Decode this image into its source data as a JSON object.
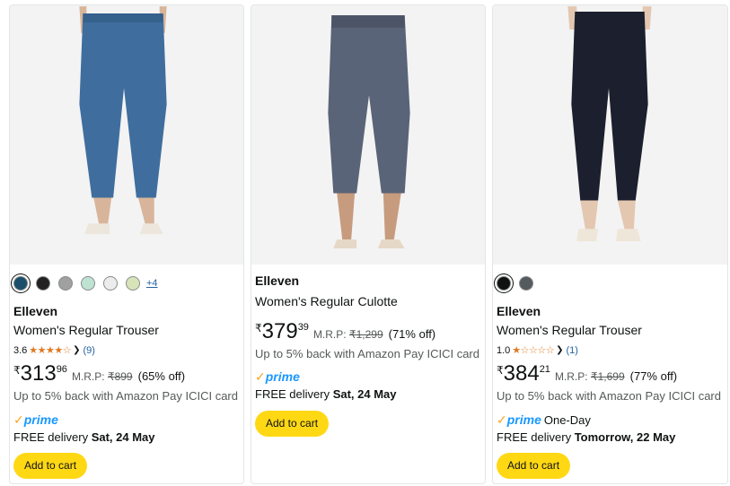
{
  "products": [
    {
      "image_alt": "Blue regular trouser",
      "colors": [
        "#1b4f6b",
        "#222222",
        "#a0a0a0",
        "#bfe3d3",
        "#ececec",
        "#d7e4b8"
      ],
      "more_colors": "+4",
      "brand": "Elleven",
      "title": "Women's Regular Trouser",
      "rating": "3.6",
      "stars": "★★★★☆",
      "review_count": "(9)",
      "price_currency": "₹",
      "price_whole": "313",
      "price_fraction": "96",
      "mrp_label": "M.R.P:",
      "mrp_value": "₹899",
      "discount": "(65% off)",
      "cashback": "Up to 5% back with Amazon Pay ICICI card",
      "prime_label": "prime",
      "prime_extra": "",
      "delivery_prefix": "FREE delivery",
      "delivery_date": "Sat, 24 May",
      "cart_label": "Add to cart"
    },
    {
      "image_alt": "Grey culotte",
      "colors": [],
      "more_colors": "",
      "brand": "Elleven",
      "title": "Women's Regular Culotte",
      "rating": "",
      "stars": "",
      "review_count": "",
      "price_currency": "₹",
      "price_whole": "379",
      "price_fraction": "39",
      "mrp_label": "M.R.P:",
      "mrp_value": "₹1,299",
      "discount": "(71% off)",
      "cashback": "Up to 5% back with Amazon Pay ICICI card",
      "prime_label": "prime",
      "prime_extra": "",
      "delivery_prefix": "FREE delivery",
      "delivery_date": "Sat, 24 May",
      "cart_label": "Add to cart"
    },
    {
      "image_alt": "Black regular trouser",
      "colors": [
        "#111111",
        "#555a5e"
      ],
      "more_colors": "",
      "brand": "Elleven",
      "title": "Women's Regular Trouser",
      "rating": "1.0",
      "stars": "★☆☆☆☆",
      "review_count": "(1)",
      "price_currency": "₹",
      "price_whole": "384",
      "price_fraction": "21",
      "mrp_label": "M.R.P:",
      "mrp_value": "₹1,699",
      "discount": "(77% off)",
      "cashback": "Up to 5% back with Amazon Pay ICICI card",
      "prime_label": "prime",
      "prime_extra": "One-Day",
      "delivery_prefix": "FREE delivery",
      "delivery_date": "Tomorrow, 22 May",
      "cart_label": "Add to cart"
    }
  ],
  "colors": {
    "cart_button": "#ffd814",
    "prime_blue": "#1a98ff",
    "prime_check": "#f6a41c",
    "star": "#de7921",
    "link": "#2162a1"
  }
}
